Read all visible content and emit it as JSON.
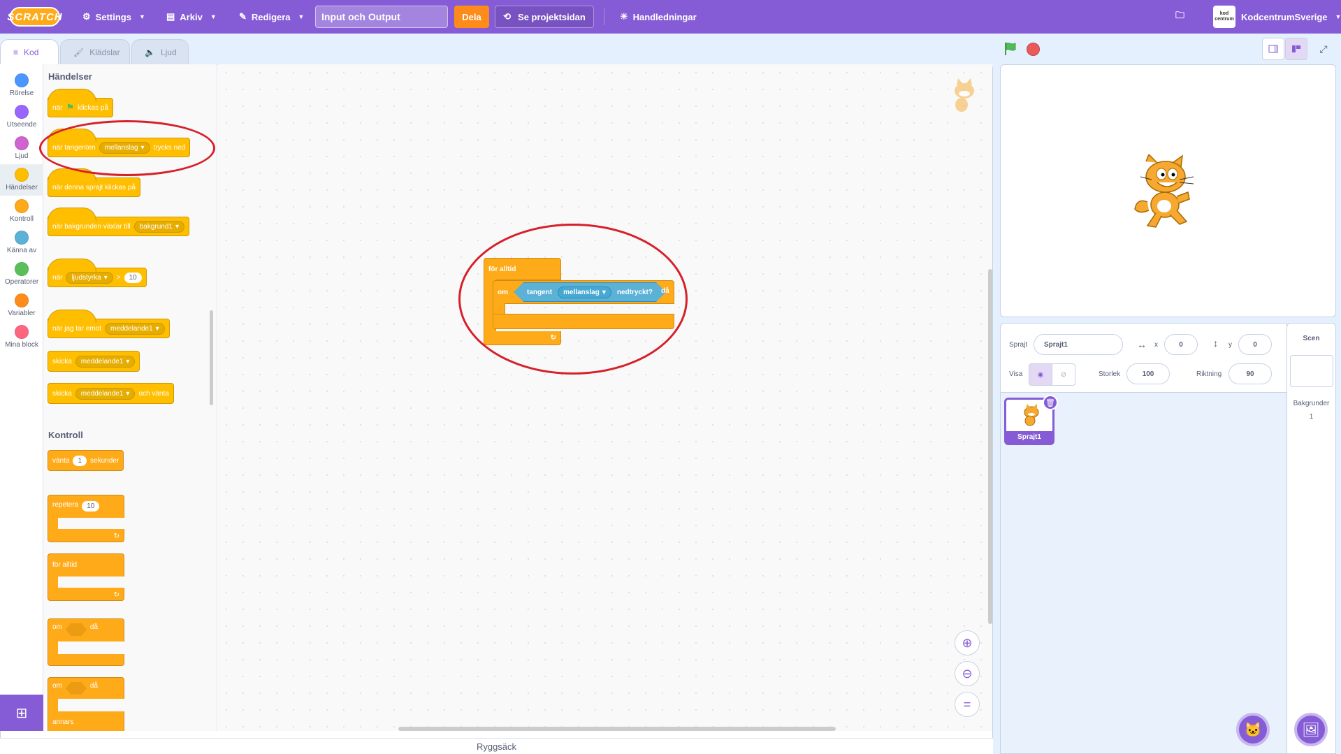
{
  "menubar": {
    "logo": "SCRATCH",
    "settings": "Settings",
    "file": "Arkiv",
    "edit": "Redigera",
    "project_title": "Input och Output",
    "share": "Dela",
    "project_page": "Se projektsidan",
    "tutorials": "Handledningar",
    "username": "KodcentrumSverige",
    "avatar_text": "kod centrum",
    "accent_color": "#855cd6"
  },
  "tabs": {
    "code": "Kod",
    "costumes": "Klädslar",
    "sounds": "Ljud"
  },
  "categories": [
    {
      "label": "Rörelse",
      "color": "#4c97ff"
    },
    {
      "label": "Utseende",
      "color": "#9966ff"
    },
    {
      "label": "Ljud",
      "color": "#cf63cf"
    },
    {
      "label": "Händelser",
      "color": "#ffbf00"
    },
    {
      "label": "Kontroll",
      "color": "#ffab19"
    },
    {
      "label": "Känna av",
      "color": "#5cb1d6"
    },
    {
      "label": "Operatorer",
      "color": "#59c059"
    },
    {
      "label": "Variabler",
      "color": "#ff8c1a"
    },
    {
      "label": "Mina block",
      "color": "#ff6680"
    }
  ],
  "palette": {
    "events_heading": "Händelser",
    "when_flag_1": "när",
    "when_flag_2": "klickas på",
    "when_key_1": "när tangenten",
    "when_key_dd": "mellanslag",
    "when_key_2": "trycks ned",
    "when_sprite_clicked": "när denna sprajt klickas på",
    "when_backdrop_1": "när bakgrunden växlar till",
    "when_backdrop_dd": "bakgrund1",
    "when_loud_1": "när",
    "when_loud_dd": "ljudstyrka",
    "when_loud_op": ">",
    "when_loud_val": "10",
    "when_receive_1": "när jag tar emot",
    "when_receive_dd": "meddelande1",
    "broadcast_1": "skicka",
    "broadcast_dd": "meddelande1",
    "broadcast_wait_1": "skicka",
    "broadcast_wait_dd": "meddelande1",
    "broadcast_wait_2": "och vänta",
    "control_heading": "Kontroll",
    "wait_1": "vänta",
    "wait_val": "1",
    "wait_2": "sekunder",
    "repeat_1": "repetera",
    "repeat_val": "10",
    "forever": "för alltid",
    "if_1": "om",
    "if_2": "då",
    "ifelse_1": "om",
    "ifelse_2": "då",
    "ifelse_else": "annars"
  },
  "script": {
    "forever": "för alltid",
    "if": "om",
    "key_1": "tangent",
    "key_dd": "mellanslag",
    "key_2": "nedtryckt?",
    "then": "då"
  },
  "backpack": "Ryggsäck",
  "sprite_info": {
    "sprite_label": "Sprajt",
    "sprite_name": "Sprajt1",
    "x_label": "x",
    "x_value": "0",
    "y_label": "y",
    "y_value": "0",
    "show_label": "Visa",
    "size_label": "Storlek",
    "size_value": "100",
    "direction_label": "Riktning",
    "direction_value": "90"
  },
  "sprites": [
    {
      "name": "Sprajt1"
    }
  ],
  "scene": {
    "title": "Scen",
    "backdrops_label": "Bakgrunder",
    "backdrops_count": "1"
  }
}
